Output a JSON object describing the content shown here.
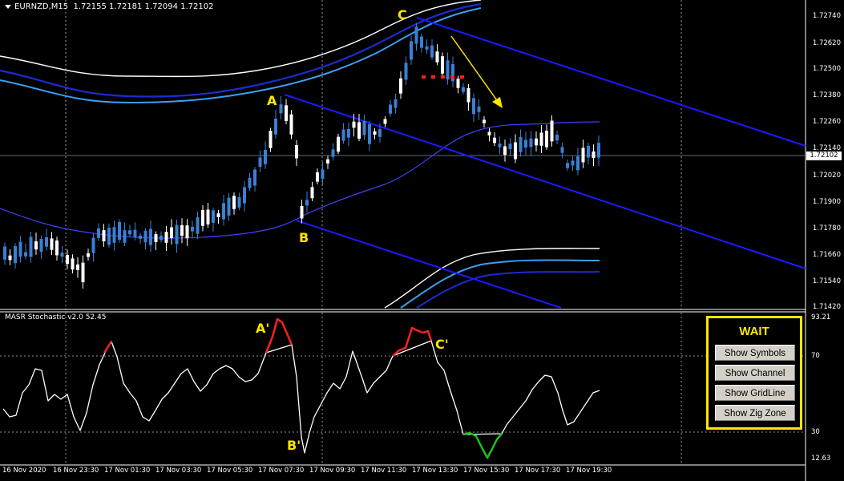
{
  "header": {
    "symbol": "EURNZD,M15",
    "ohlc": "1.72155 1.72181 1.72094 1.72102"
  },
  "indicator": {
    "title": "MASR Stochastic v2.0 52.45"
  },
  "current_price": "1.72102",
  "price_axis": {
    "labels": [
      "1.72740",
      "1.72620",
      "1.72500",
      "1.72380",
      "1.72260",
      "1.72140",
      "1.72020",
      "1.71900",
      "1.71780",
      "1.71660",
      "1.71540",
      "1.71420"
    ]
  },
  "sub_axis": {
    "labels": [
      "93.21",
      "70",
      "30",
      "12.63"
    ]
  },
  "time_axis": {
    "labels": [
      "16 Nov 2020",
      "16 Nov 23:30",
      "17 Nov 01:30",
      "17 Nov 03:30",
      "17 Nov 05:30",
      "17 Nov 07:30",
      "17 Nov 09:30",
      "17 Nov 11:30",
      "17 Nov 13:30",
      "17 Nov 15:30",
      "17 Nov 17:30",
      "17 Nov 19:30"
    ]
  },
  "wave_labels": {
    "a": "A",
    "b": "B",
    "c": "C",
    "a_prime": "A'",
    "b_prime": "B'",
    "c_prime": "C'"
  },
  "panel": {
    "status": "WAIT",
    "buttons": [
      "Show Symbols",
      "Show Channel",
      "Show GridLine",
      "Show Zig Zone"
    ]
  },
  "colors": {
    "background": "#000000",
    "bull_candle": "#ffffff",
    "bear_candle": "#3a7fd5",
    "channel": "#1a1aff",
    "band_outer": "#ffffff",
    "band_mid": "#3a9ff0",
    "band_inner": "#1c2bd0",
    "arrow": "#ffe600",
    "stoch_line": "#ffffff",
    "stoch_overbought": "#ff2020",
    "stoch_oversold": "#20c020",
    "panel_border": "#ffe600"
  }
}
